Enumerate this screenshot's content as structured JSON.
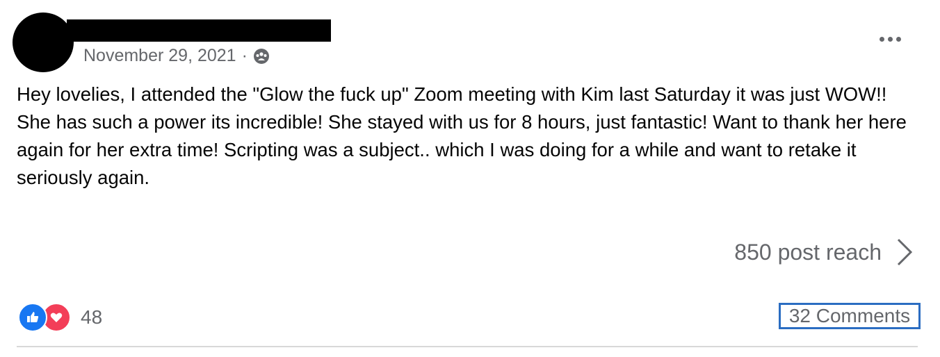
{
  "post": {
    "date": "November 29, 2021",
    "separator": "·",
    "audience_icon": "group-audience-icon",
    "text": "Hey lovelies, I attended the \"Glow the fuck up\" Zoom meeting with Kim last Saturday it was just WOW!! She has such a power its incredible! She stayed with us for 8 hours, just fantastic! Want to thank her here again for her extra time! Scripting was a subject.. which I was doing for a while and want to retake it seriously again.",
    "reach_label": "850 post reach",
    "reaction_count": "48",
    "comments_label": "32 Comments"
  },
  "colors": {
    "like": "#1877f2",
    "love": "#f33e58",
    "highlight_border": "#2b6dc2",
    "secondary_text": "#65676b"
  }
}
